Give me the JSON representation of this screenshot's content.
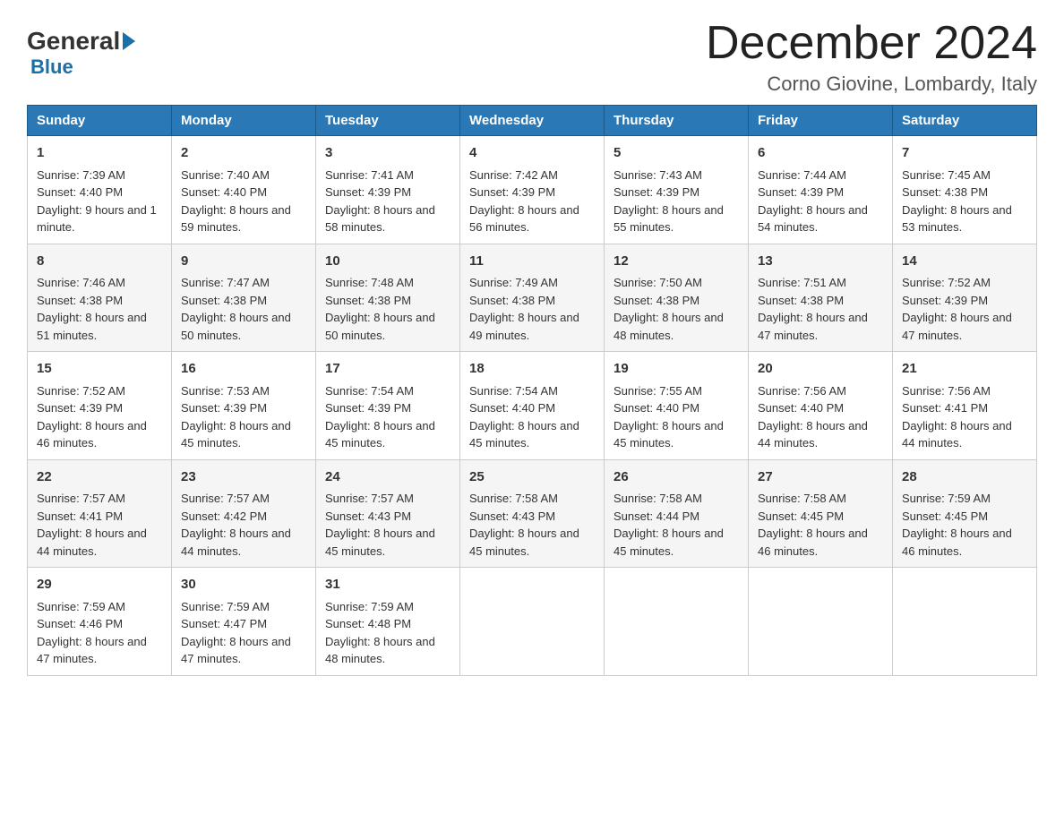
{
  "header": {
    "logo_general": "General",
    "logo_blue": "Blue",
    "month_title": "December 2024",
    "location": "Corno Giovine, Lombardy, Italy"
  },
  "days_of_week": [
    "Sunday",
    "Monday",
    "Tuesday",
    "Wednesday",
    "Thursday",
    "Friday",
    "Saturday"
  ],
  "weeks": [
    [
      {
        "day": "1",
        "sunrise": "7:39 AM",
        "sunset": "4:40 PM",
        "daylight": "9 hours and 1 minute."
      },
      {
        "day": "2",
        "sunrise": "7:40 AM",
        "sunset": "4:40 PM",
        "daylight": "8 hours and 59 minutes."
      },
      {
        "day": "3",
        "sunrise": "7:41 AM",
        "sunset": "4:39 PM",
        "daylight": "8 hours and 58 minutes."
      },
      {
        "day": "4",
        "sunrise": "7:42 AM",
        "sunset": "4:39 PM",
        "daylight": "8 hours and 56 minutes."
      },
      {
        "day": "5",
        "sunrise": "7:43 AM",
        "sunset": "4:39 PM",
        "daylight": "8 hours and 55 minutes."
      },
      {
        "day": "6",
        "sunrise": "7:44 AM",
        "sunset": "4:39 PM",
        "daylight": "8 hours and 54 minutes."
      },
      {
        "day": "7",
        "sunrise": "7:45 AM",
        "sunset": "4:38 PM",
        "daylight": "8 hours and 53 minutes."
      }
    ],
    [
      {
        "day": "8",
        "sunrise": "7:46 AM",
        "sunset": "4:38 PM",
        "daylight": "8 hours and 51 minutes."
      },
      {
        "day": "9",
        "sunrise": "7:47 AM",
        "sunset": "4:38 PM",
        "daylight": "8 hours and 50 minutes."
      },
      {
        "day": "10",
        "sunrise": "7:48 AM",
        "sunset": "4:38 PM",
        "daylight": "8 hours and 50 minutes."
      },
      {
        "day": "11",
        "sunrise": "7:49 AM",
        "sunset": "4:38 PM",
        "daylight": "8 hours and 49 minutes."
      },
      {
        "day": "12",
        "sunrise": "7:50 AM",
        "sunset": "4:38 PM",
        "daylight": "8 hours and 48 minutes."
      },
      {
        "day": "13",
        "sunrise": "7:51 AM",
        "sunset": "4:38 PM",
        "daylight": "8 hours and 47 minutes."
      },
      {
        "day": "14",
        "sunrise": "7:52 AM",
        "sunset": "4:39 PM",
        "daylight": "8 hours and 47 minutes."
      }
    ],
    [
      {
        "day": "15",
        "sunrise": "7:52 AM",
        "sunset": "4:39 PM",
        "daylight": "8 hours and 46 minutes."
      },
      {
        "day": "16",
        "sunrise": "7:53 AM",
        "sunset": "4:39 PM",
        "daylight": "8 hours and 45 minutes."
      },
      {
        "day": "17",
        "sunrise": "7:54 AM",
        "sunset": "4:39 PM",
        "daylight": "8 hours and 45 minutes."
      },
      {
        "day": "18",
        "sunrise": "7:54 AM",
        "sunset": "4:40 PM",
        "daylight": "8 hours and 45 minutes."
      },
      {
        "day": "19",
        "sunrise": "7:55 AM",
        "sunset": "4:40 PM",
        "daylight": "8 hours and 45 minutes."
      },
      {
        "day": "20",
        "sunrise": "7:56 AM",
        "sunset": "4:40 PM",
        "daylight": "8 hours and 44 minutes."
      },
      {
        "day": "21",
        "sunrise": "7:56 AM",
        "sunset": "4:41 PM",
        "daylight": "8 hours and 44 minutes."
      }
    ],
    [
      {
        "day": "22",
        "sunrise": "7:57 AM",
        "sunset": "4:41 PM",
        "daylight": "8 hours and 44 minutes."
      },
      {
        "day": "23",
        "sunrise": "7:57 AM",
        "sunset": "4:42 PM",
        "daylight": "8 hours and 44 minutes."
      },
      {
        "day": "24",
        "sunrise": "7:57 AM",
        "sunset": "4:43 PM",
        "daylight": "8 hours and 45 minutes."
      },
      {
        "day": "25",
        "sunrise": "7:58 AM",
        "sunset": "4:43 PM",
        "daylight": "8 hours and 45 minutes."
      },
      {
        "day": "26",
        "sunrise": "7:58 AM",
        "sunset": "4:44 PM",
        "daylight": "8 hours and 45 minutes."
      },
      {
        "day": "27",
        "sunrise": "7:58 AM",
        "sunset": "4:45 PM",
        "daylight": "8 hours and 46 minutes."
      },
      {
        "day": "28",
        "sunrise": "7:59 AM",
        "sunset": "4:45 PM",
        "daylight": "8 hours and 46 minutes."
      }
    ],
    [
      {
        "day": "29",
        "sunrise": "7:59 AM",
        "sunset": "4:46 PM",
        "daylight": "8 hours and 47 minutes."
      },
      {
        "day": "30",
        "sunrise": "7:59 AM",
        "sunset": "4:47 PM",
        "daylight": "8 hours and 47 minutes."
      },
      {
        "day": "31",
        "sunrise": "7:59 AM",
        "sunset": "4:48 PM",
        "daylight": "8 hours and 48 minutes."
      },
      null,
      null,
      null,
      null
    ]
  ],
  "labels": {
    "sunrise_prefix": "Sunrise: ",
    "sunset_prefix": "Sunset: ",
    "daylight_prefix": "Daylight: "
  }
}
